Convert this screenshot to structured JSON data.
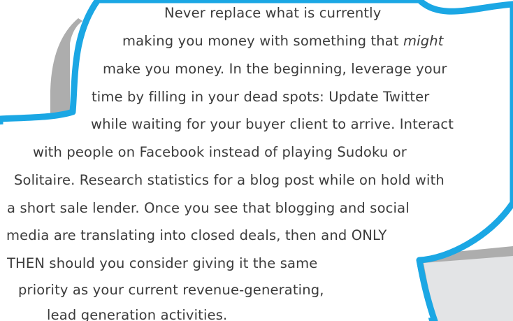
{
  "quote": {
    "line_1": "Never replace what is currently",
    "line_2_prefix": "making you money with something that ",
    "line_2_emphasis": "might",
    "line_3": "make you money. In the beginning, leverage your",
    "line_4": "time by filling in your dead spots: Update Twitter",
    "line_5": "while waiting for your buyer client to arrive. Interact",
    "line_6": "with people on Facebook instead of playing Sudoku or",
    "line_7": "Solitaire. Research statistics for a blog post while on hold with",
    "line_8": "a short sale lender. Once you see that blogging and social",
    "line_9": "media are translating into closed deals, then and ONLY",
    "line_10": "THEN should you consider giving it the same",
    "line_11": "priority as your current revenue-generating,",
    "line_12": "lead generation activities."
  },
  "colors": {
    "bubble_outline": "#1ba7e4",
    "shadow": "#adadad",
    "shadow_light": "#e3e4e6",
    "text": "#3b3b3b",
    "fill": "#ffffff"
  }
}
